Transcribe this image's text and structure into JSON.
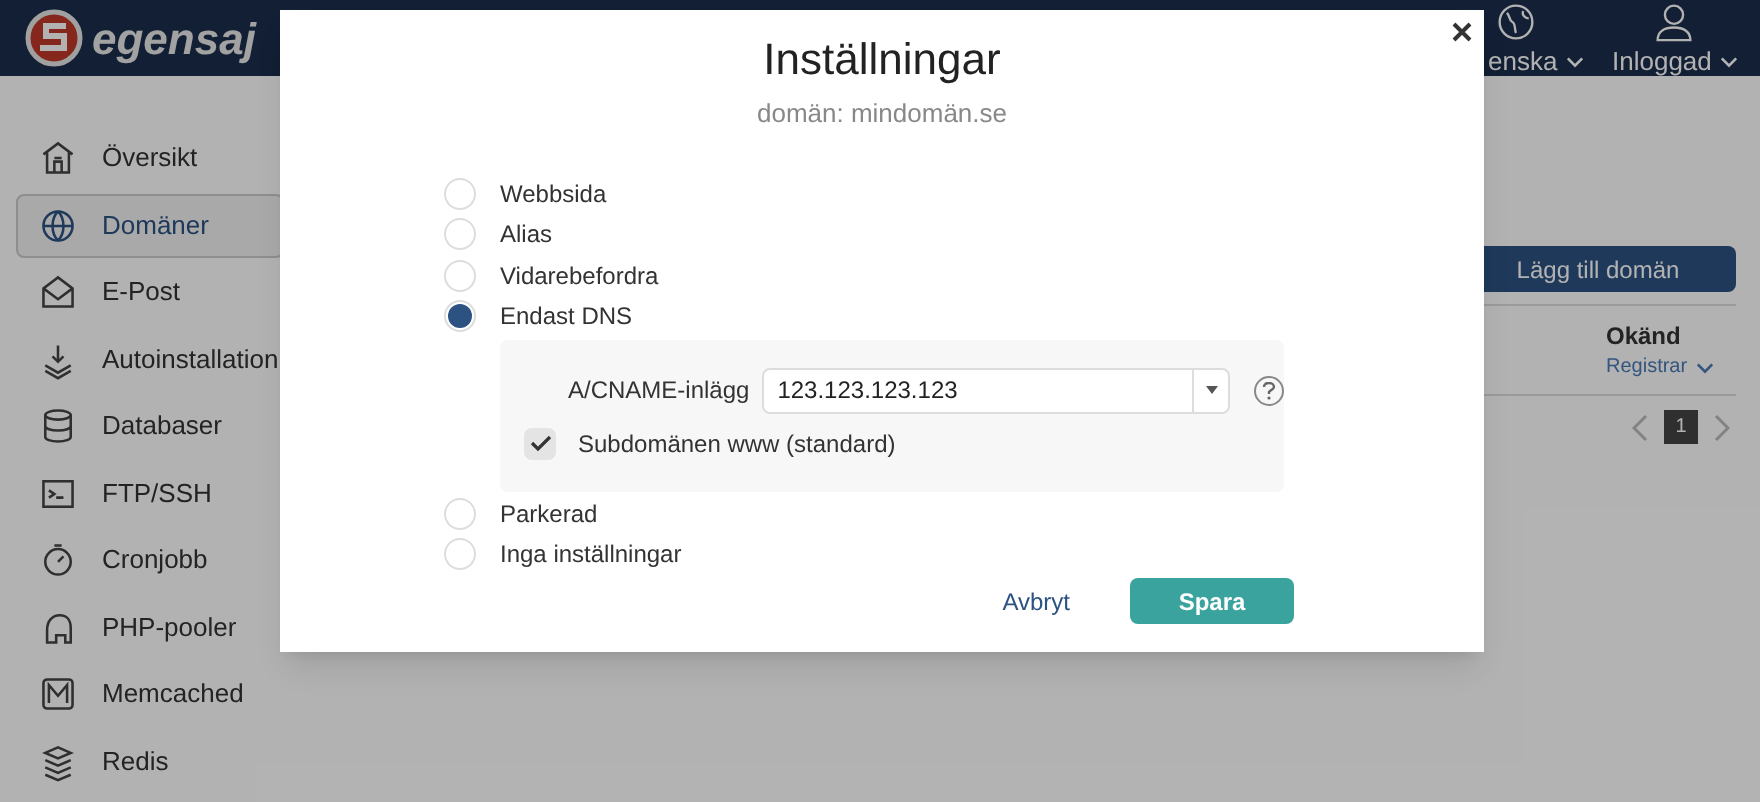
{
  "header": {
    "brand": "egensaj",
    "language": {
      "label": "enska"
    },
    "user": {
      "label": "Inloggad"
    }
  },
  "sidebar": {
    "items": [
      {
        "label": "Översikt",
        "selected": false
      },
      {
        "label": "Domäner",
        "selected": true
      },
      {
        "label": "E-Post",
        "selected": false
      },
      {
        "label": "Autoinstallation",
        "selected": false
      },
      {
        "label": "Databaser",
        "selected": false
      },
      {
        "label": "FTP/SSH",
        "selected": false
      },
      {
        "label": "Cronjobb",
        "selected": false
      },
      {
        "label": "PHP-pooler",
        "selected": false
      },
      {
        "label": "Memcached",
        "selected": false
      },
      {
        "label": "Redis",
        "selected": false
      }
    ]
  },
  "content": {
    "add_button": "Lägg till domän",
    "status": "Okänd",
    "registrar": "Registrar",
    "pagination": [
      {
        "label": "1",
        "selected": true
      }
    ]
  },
  "modal": {
    "title": "Inställningar",
    "subtitle": "domän: mindomän.se",
    "options": [
      {
        "label": "Webbsida",
        "selected": false
      },
      {
        "label": "Alias",
        "selected": false
      },
      {
        "label": "Vidarebefordra",
        "selected": false
      },
      {
        "label": "Endast DNS",
        "selected": true,
        "kind": "dns"
      },
      {
        "label": "Parkerad",
        "selected": false
      },
      {
        "label": "Inga inställningar",
        "selected": false
      }
    ],
    "dns": {
      "field_label": "A/CNAME-inlägg",
      "value": "123.123.123.123",
      "checkbox": {
        "label": "Subdomänen www (standard)",
        "checked": true
      }
    },
    "cancel": "Avbryt",
    "save": "Spara"
  }
}
